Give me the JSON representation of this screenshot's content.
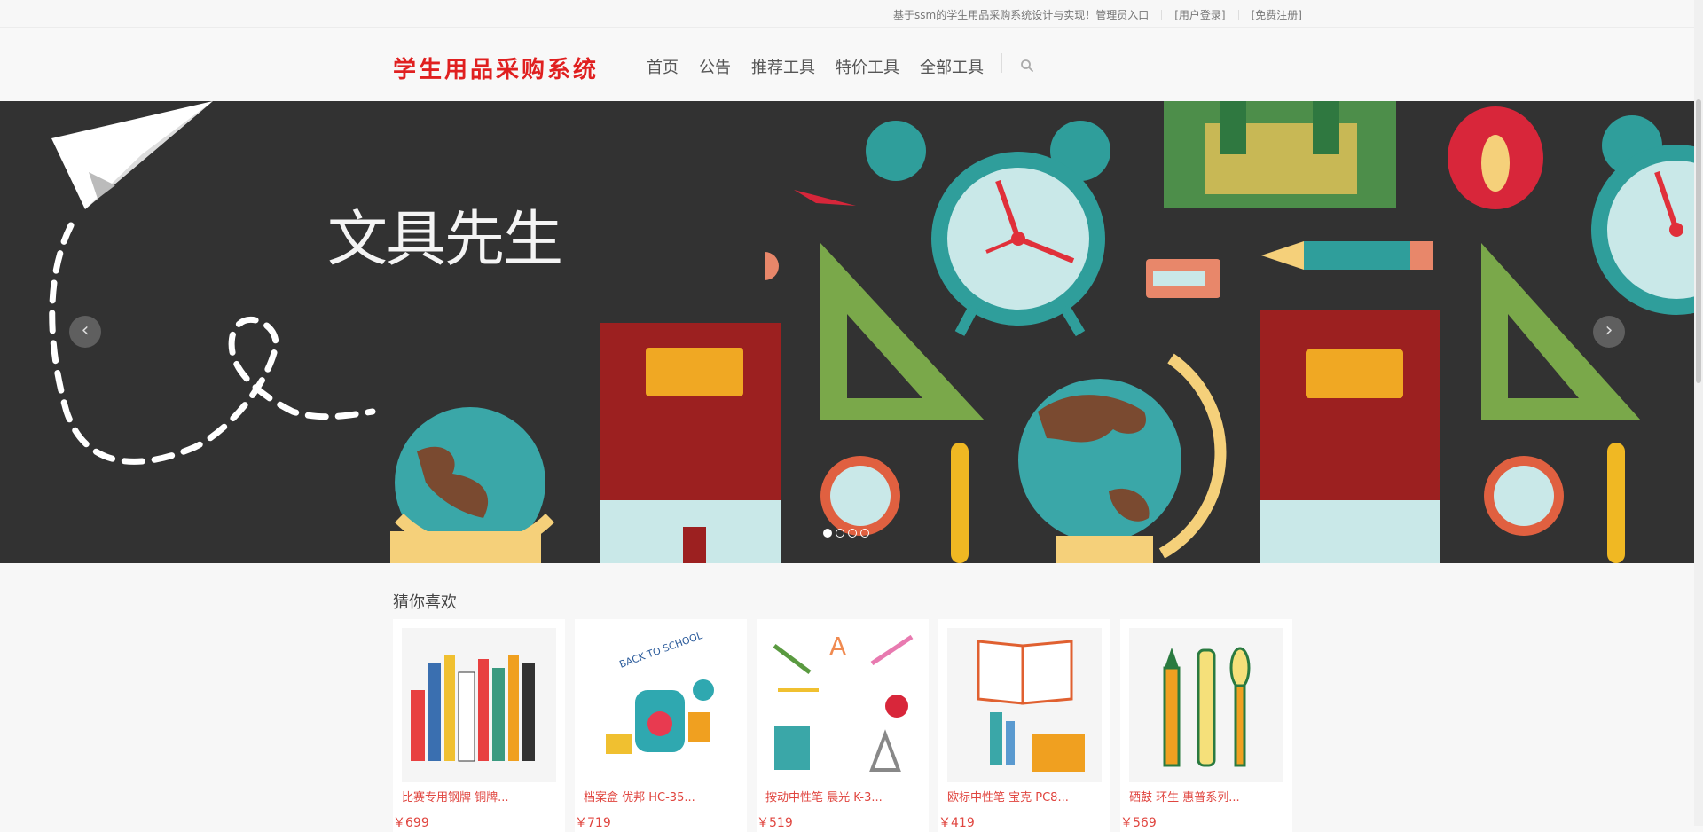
{
  "topbar": {
    "intro": "基于ssm的学生用品采购系统设计与实现！管理员入口",
    "login": "[用户登录]",
    "register": "[免费注册]"
  },
  "header": {
    "logo": "学生用品采购系统",
    "nav": [
      "首页",
      "公告",
      "推荐工具",
      "特价工具",
      "全部工具"
    ]
  },
  "banner": {
    "title": "文具先生",
    "prev": "‹",
    "next": "›",
    "slides": 4,
    "active_slide": 1
  },
  "recommend": {
    "title": "猜你喜欢",
    "products": [
      {
        "name": "比赛专用钢牌 铜牌...",
        "price": "￥699"
      },
      {
        "name": "档案盒 优邦 HC-35...",
        "price": "￥719"
      },
      {
        "name": "按动中性笔 晨光 K-3...",
        "price": "￥519"
      },
      {
        "name": "欧标中性笔 宝克 PC8...",
        "price": "￥419"
      },
      {
        "name": "硒鼓 环生 惠普系列...",
        "price": "￥569"
      }
    ]
  },
  "colors": {
    "brand": "#e02020",
    "banner_bg": "#323232",
    "price": "#e0453f"
  },
  "icons": {
    "search": "search-icon",
    "prev": "chevron-left-icon",
    "next": "chevron-right-icon"
  }
}
